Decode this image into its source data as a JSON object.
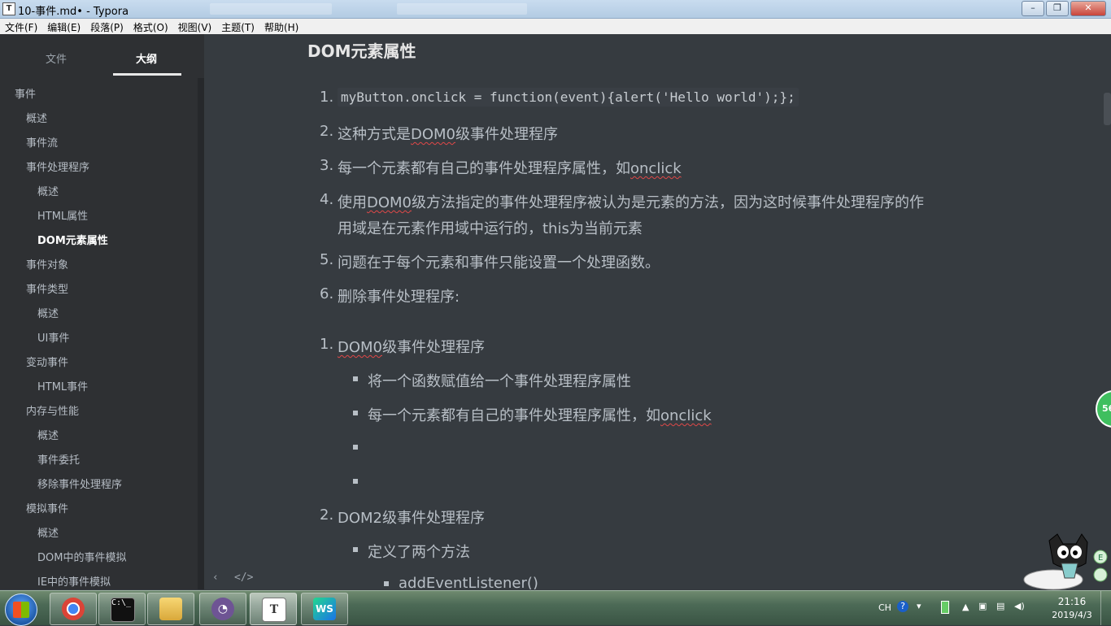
{
  "window": {
    "title": "10-事件.md• - Typora"
  },
  "menu": [
    "文件(F)",
    "编辑(E)",
    "段落(P)",
    "格式(O)",
    "视图(V)",
    "主题(T)",
    "帮助(H)"
  ],
  "sidebar": {
    "tabs": [
      "文件",
      "大纲"
    ],
    "active_tab": "大纲",
    "outline": [
      {
        "label": "事件",
        "level": 1
      },
      {
        "label": "概述",
        "level": 2
      },
      {
        "label": "事件流",
        "level": 2
      },
      {
        "label": "事件处理程序",
        "level": 2
      },
      {
        "label": "概述",
        "level": 3
      },
      {
        "label": "HTML属性",
        "level": 3
      },
      {
        "label": "DOM元素属性",
        "level": 3,
        "active": true
      },
      {
        "label": "事件对象",
        "level": 2
      },
      {
        "label": "事件类型",
        "level": 2
      },
      {
        "label": "概述",
        "level": 3
      },
      {
        "label": "UI事件",
        "level": 3
      },
      {
        "label": "变动事件",
        "level": 2
      },
      {
        "label": "HTML事件",
        "level": 3
      },
      {
        "label": "内存与性能",
        "level": 2
      },
      {
        "label": "概述",
        "level": 3
      },
      {
        "label": "事件委托",
        "level": 3
      },
      {
        "label": "移除事件处理程序",
        "level": 3
      },
      {
        "label": "模拟事件",
        "level": 2
      },
      {
        "label": "概述",
        "level": 3
      },
      {
        "label": "DOM中的事件模拟",
        "level": 3
      },
      {
        "label": "IE中的事件模拟",
        "level": 3
      }
    ]
  },
  "content": {
    "heading": "DOM元素属性",
    "list1": {
      "n1": "1.",
      "item1_code": "myButton.onclick = function(event){alert('Hello world');};",
      "n2": "2.",
      "item2_a": "这种方式是",
      "item2_b": "DOM0",
      "item2_c": "级事件处理程序",
      "n3": "3.",
      "item3_a": "每一个元素都有自己的事件处理程序属性，如",
      "item3_b": "onclick",
      "n4": "4.",
      "item4_a": "使用",
      "item4_b": "DOM0",
      "item4_c": "级方法指定的事件处理程序被认为是元素的方法，因为这时候事件处理程序的作",
      "item4_line2": "用域是在元素作用域中运行的，this为当前元素",
      "n5": "5.",
      "item5": "问题在于每个元素和事件只能设置一个处理函数。",
      "n6": "6.",
      "item6": "删除事件处理程序:"
    },
    "list2": {
      "n1": "1.",
      "item1_a": "DOM0",
      "item1_b": "级事件处理程序",
      "sub1": "将一个函数赋值给一个事件处理程序属性",
      "sub2_a": "每一个元素都有自己的事件处理程序属性，如",
      "sub2_b": "onclick",
      "n2": "2.",
      "item2": "DOM2级事件处理程序",
      "sub3": "定义了两个方法",
      "sub4": "addEventListener()"
    }
  },
  "bottombar": {
    "back_icon": "‹",
    "source_icon": "</>"
  },
  "badge": {
    "text": "56"
  },
  "taskbar": {
    "apps": [
      "chrome",
      "cmd",
      "explorer",
      "github-desktop",
      "typora",
      "webstorm"
    ],
    "typora_label": "T",
    "webstorm_label": "WS",
    "tray": {
      "ime": "CH",
      "time": "21:16",
      "date": "2019/4/3"
    }
  }
}
